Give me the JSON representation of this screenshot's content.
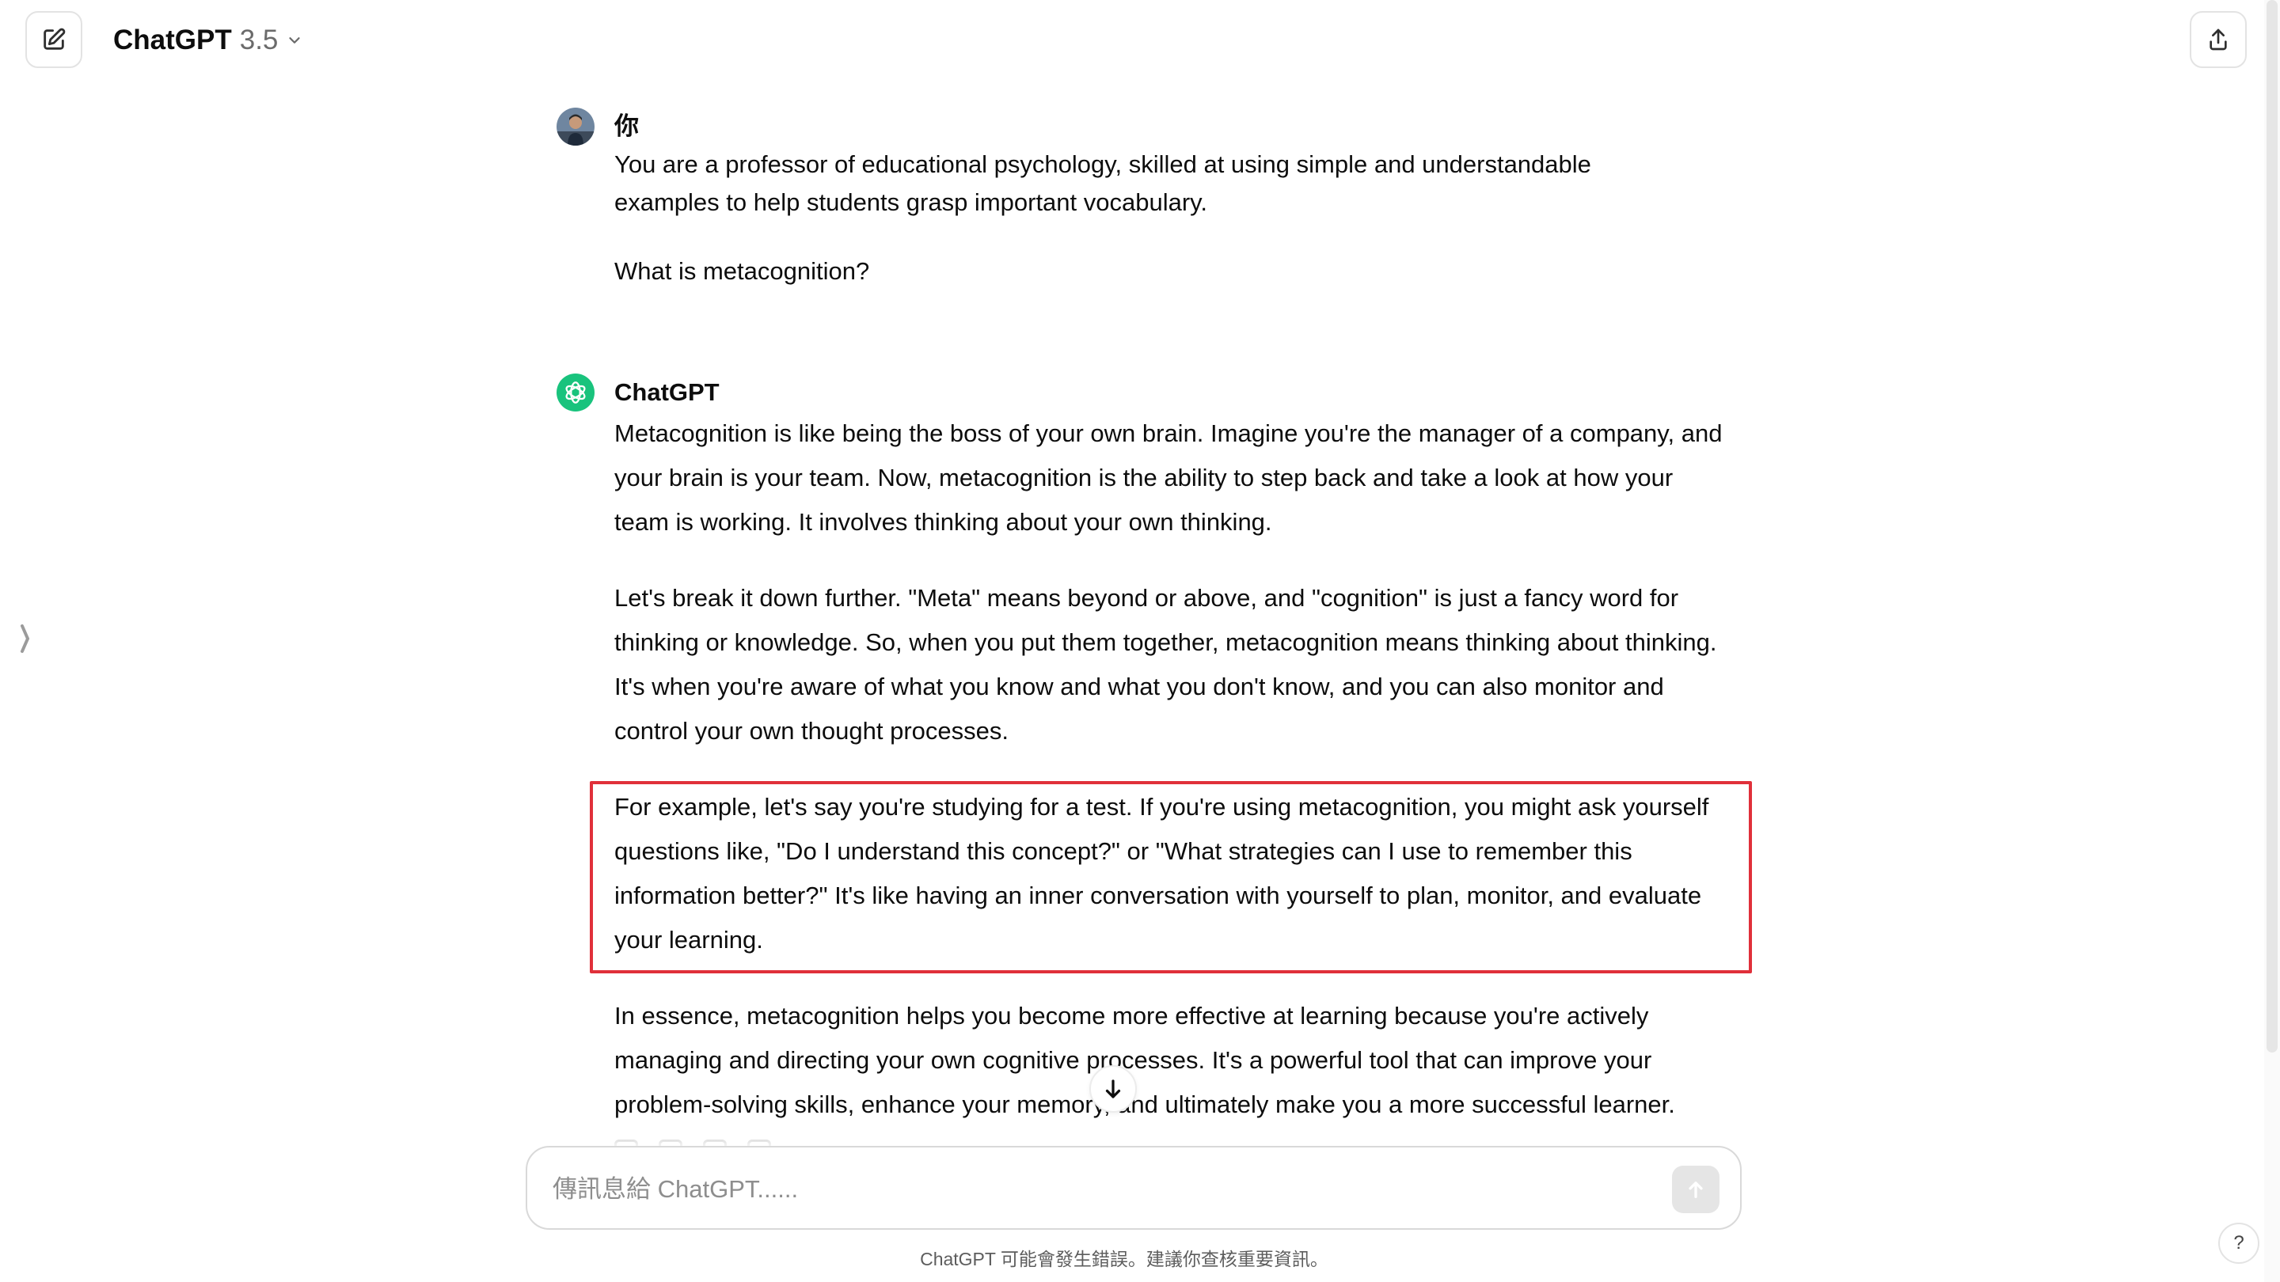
{
  "header": {
    "model_name": "ChatGPT",
    "model_version": "3.5",
    "new_chat_icon": "edit-icon",
    "share_icon": "share-icon"
  },
  "conversation": {
    "user": {
      "author": "你",
      "paragraphs": [
        "You are a professor of educational psychology, skilled at using simple and understandable examples to help students grasp important vocabulary.",
        "What is metacognition?"
      ]
    },
    "assistant": {
      "author": "ChatGPT",
      "paragraphs": [
        "Metacognition is like being the boss of your own brain. Imagine you're the manager of a company, and your brain is your team. Now, metacognition is the ability to step back and take a look at how your team is working. It involves thinking about your own thinking.",
        "Let's break it down further. \"Meta\" means beyond or above, and \"cognition\" is just a fancy word for thinking or knowledge. So, when you put them together, metacognition means thinking about thinking. It's when you're aware of what you know and what you don't know, and you can also monitor and control your own thought processes.",
        "For example, let's say you're studying for a test. If you're using metacognition, you might ask yourself questions like, \"Do I understand this concept?\" or \"What strategies can I use to remember this information better?\" It's like having an inner conversation with yourself to plan, monitor, and evaluate your learning.",
        "In essence, metacognition helps you become more effective at learning because you're actively managing and directing your own cognitive processes. It's a powerful tool that can improve your problem-solving skills, enhance your memory, and ultimately make you a more successful learner."
      ]
    }
  },
  "composer": {
    "placeholder": "傳訊息給 ChatGPT......"
  },
  "footer": {
    "disclaimer": "ChatGPT 可能會發生錯誤。建議你查核重要資訊。",
    "help_label": "?"
  },
  "colors": {
    "highlight_border": "#e0303a",
    "chatgpt_brand": "#19c37d"
  }
}
